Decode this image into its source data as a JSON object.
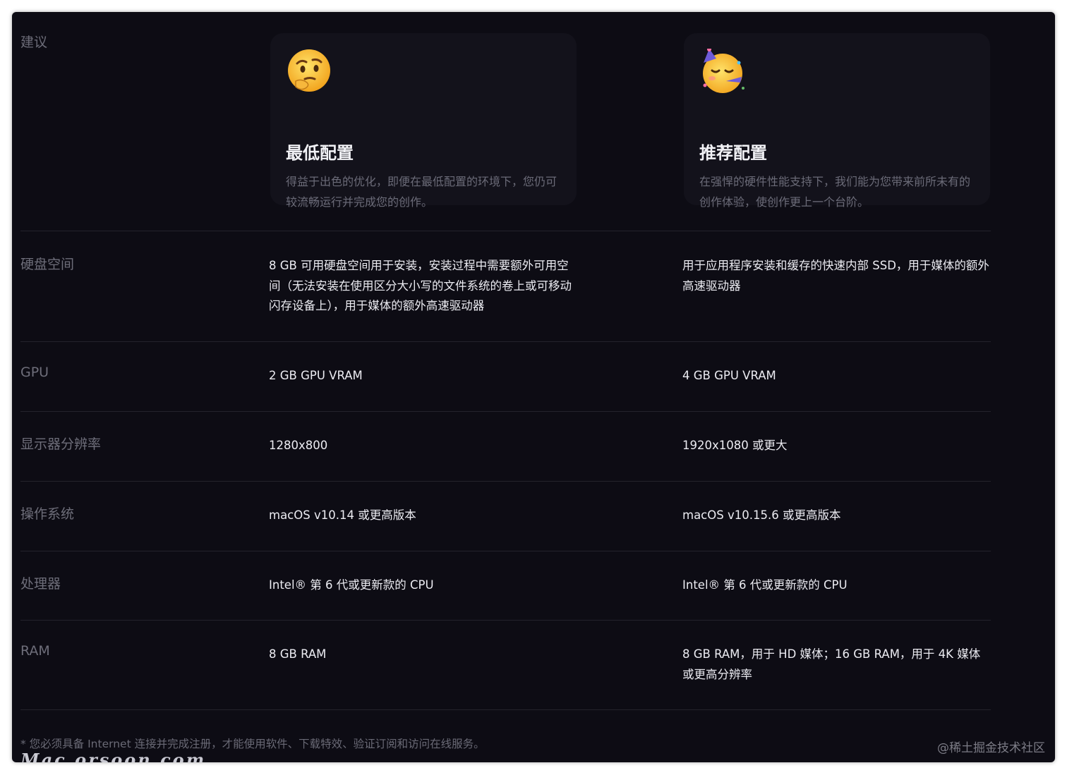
{
  "section": {
    "label": "建议"
  },
  "cards": [
    {
      "emoji": "🤔",
      "title": "最低配置",
      "description": "得益于出色的优化，即便在最低配置的环境下，您仍可较流畅运行并完成您的创作。"
    },
    {
      "emoji": "🥳",
      "title": "推荐配置",
      "description": "在强悍的硬件性能支持下，我们能为您带来前所未有的创作体验，使创作更上一个台阶。"
    }
  ],
  "rows": [
    {
      "label": "硬盘空间",
      "min": "8 GB 可用硬盘空间用于安装，安装过程中需要额外可用空间（无法安装在使用区分大小写的文件系统的卷上或可移动闪存设备上），用于媒体的额外高速驱动器",
      "rec": "用于应用程序安装和缓存的快速内部 SSD，用于媒体的额外高速驱动器"
    },
    {
      "label": "GPU",
      "min": "2 GB GPU VRAM",
      "rec": "4 GB GPU VRAM"
    },
    {
      "label": "显示器分辨率",
      "min": "1280x800",
      "rec": "1920x1080 或更大"
    },
    {
      "label": "操作系统",
      "min": "macOS v10.14 或更高版本",
      "rec": "macOS v10.15.6 或更高版本"
    },
    {
      "label": "处理器",
      "min": "Intel® 第 6 代或更新款的 CPU",
      "rec": "Intel® 第 6 代或更新款的 CPU"
    },
    {
      "label": "RAM",
      "min": "8 GB RAM",
      "rec": "8 GB RAM，用于 HD 媒体；16 GB RAM，用于 4K 媒体或更高分辨率"
    }
  ],
  "footnote": "* 您必须具备 Internet 连接并完成注册，才能使用软件、下载特效、验证订阅和访问在线服务。",
  "watermarks": {
    "left": "Mac.orsoon.com",
    "right": "@稀土掘金技术社区"
  }
}
